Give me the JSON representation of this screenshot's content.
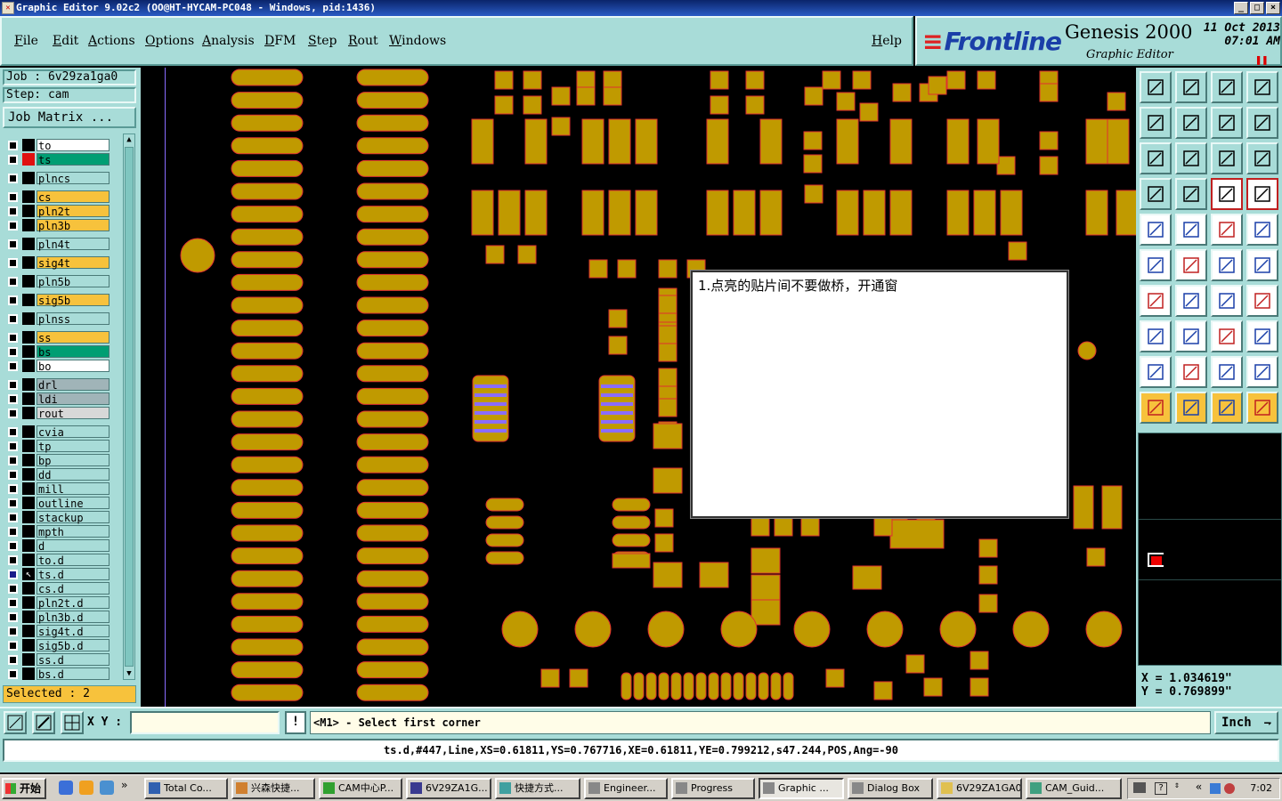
{
  "window": {
    "title": "Graphic Editor 9.02c2 (OO@HT-HYCAM-PC048 - Windows, pid:1436)"
  },
  "menu": {
    "items": [
      "File",
      "Edit",
      "Actions",
      "Options",
      "Analysis",
      "DFM",
      "Step",
      "Rout",
      "Windows"
    ],
    "help": "Help"
  },
  "brand": {
    "logo": "Frontline",
    "product": "Genesis 2000",
    "subtitle": "Graphic Editor",
    "date_line1": "11 Oct 2013",
    "date_line2": "07:01 AM"
  },
  "left_panel": {
    "job": "Job : 6v29za1ga0",
    "step": "Step: cam",
    "job_matrix": "Job Matrix ...",
    "selected": "Selected : 2",
    "layers": [
      {
        "name": "to",
        "color": "#ffffff",
        "swatch": "#000000"
      },
      {
        "name": "ts",
        "color": "#009e73",
        "swatch": "#e01010"
      },
      {
        "name": "plncs",
        "color": "#a8dcd8",
        "swatch": "#000000"
      },
      {
        "name": "cs",
        "color": "#f7c23c",
        "swatch": "#000000"
      },
      {
        "name": "pln2t",
        "color": "#f7c23c",
        "swatch": "#000000"
      },
      {
        "name": "pln3b",
        "color": "#f7c23c",
        "swatch": "#000000"
      },
      {
        "name": "pln4t",
        "color": "#a8dcd8",
        "swatch": "#000000"
      },
      {
        "name": "sig4t",
        "color": "#f7c23c",
        "swatch": "#000000"
      },
      {
        "name": "pln5b",
        "color": "#a8dcd8",
        "swatch": "#000000"
      },
      {
        "name": "sig5b",
        "color": "#f7c23c",
        "swatch": "#000000"
      },
      {
        "name": "plnss",
        "color": "#a8dcd8",
        "swatch": "#000000"
      },
      {
        "name": "ss",
        "color": "#f7c23c",
        "swatch": "#000000"
      },
      {
        "name": "bs",
        "color": "#009e73",
        "swatch": "#000000"
      },
      {
        "name": "bo",
        "color": "#ffffff",
        "swatch": "#000000"
      },
      {
        "name": "drl",
        "color": "#a0b4b8",
        "swatch": "#000000"
      },
      {
        "name": "ldi",
        "color": "#a0b4b8",
        "swatch": "#000000"
      },
      {
        "name": "rout",
        "color": "#d8d8d8",
        "swatch": "#000000"
      },
      {
        "name": "cvia",
        "color": "#a8dcd8",
        "swatch": "#000000"
      },
      {
        "name": "tp",
        "color": "#a8dcd8",
        "swatch": "#000000"
      },
      {
        "name": "bp",
        "color": "#a8dcd8",
        "swatch": "#000000"
      },
      {
        "name": "dd",
        "color": "#a8dcd8",
        "swatch": "#000000"
      },
      {
        "name": "mill",
        "color": "#a8dcd8",
        "swatch": "#000000"
      },
      {
        "name": "outline",
        "color": "#a8dcd8",
        "swatch": "#000000"
      },
      {
        "name": "stackup",
        "color": "#a8dcd8",
        "swatch": "#000000"
      },
      {
        "name": "mpth",
        "color": "#a8dcd8",
        "swatch": "#000000"
      },
      {
        "name": "d",
        "color": "#a8dcd8",
        "swatch": "#000000"
      },
      {
        "name": "to.d",
        "color": "#a8dcd8",
        "swatch": "#000000"
      },
      {
        "name": "ts.d",
        "color": "#a8dcd8",
        "swatch": "#000000"
      },
      {
        "name": "cs.d",
        "color": "#a8dcd8",
        "swatch": "#000000"
      },
      {
        "name": "pln2t.d",
        "color": "#a8dcd8",
        "swatch": "#000000"
      },
      {
        "name": "pln3b.d",
        "color": "#a8dcd8",
        "swatch": "#000000"
      },
      {
        "name": "sig4t.d",
        "color": "#a8dcd8",
        "swatch": "#000000"
      },
      {
        "name": "sig5b.d",
        "color": "#a8dcd8",
        "swatch": "#000000"
      },
      {
        "name": "ss.d",
        "color": "#a8dcd8",
        "swatch": "#000000"
      },
      {
        "name": "bs.d",
        "color": "#a8dcd8",
        "swatch": "#000000"
      }
    ]
  },
  "dialog": {
    "message": "1.点亮的贴片间不要做桥，开通窗"
  },
  "coords": {
    "x": "X = 1.034619\"",
    "y": "Y = 0.769899\""
  },
  "command_bar": {
    "xy_label": "X Y :",
    "xy_value": "",
    "excl": "!",
    "prompt": "<M1> - Select first corner",
    "units": "Inch"
  },
  "status": {
    "line": "ts.d,#447,Line,XS=0.61811,YS=0.767716,XE=0.61811,YE=0.799212,s47.244,POS,Ang=-90"
  },
  "taskbar": {
    "start": "开始",
    "tasks": [
      "Total Co...",
      "兴森快捷...",
      "CAM中心P...",
      "6V29ZA1G...",
      "快捷方式...",
      "Engineer...",
      "Progress",
      "Graphic ...",
      "Dialog Box",
      "6V29ZA1GA0",
      "CAM_Guid..."
    ],
    "clock": "7:02"
  },
  "colors": {
    "panel": "#a8dcd8",
    "pad": "#c09a00",
    "pad_outline": "#e03030",
    "highlight": "#8a6cff"
  },
  "icons": {
    "toolbar": [
      "fill-icon",
      "move-icon",
      "home-icon",
      "window-icon",
      "prev-icon",
      "next-icon",
      "rotate-icon",
      "redraw-icon",
      "zoom-fit-icon",
      "pan-icon",
      "scale-1-2-icon",
      "help-icon",
      "measure-icon",
      "grid-icon",
      "snap-icon",
      "snap-red-icon",
      "circle-icon",
      "polygon-icon",
      "ruler-icon",
      "dot-icon",
      "node-icon",
      "cross-icon",
      "arc-icon",
      "arrow-icon",
      "angle-icon",
      "line-icon",
      "curve-icon",
      "flip-icon",
      "add-icon",
      "minus-icon",
      "fit-icon",
      "shapes-icon",
      "tri-a-icon",
      "tri-b-icon",
      "tri-c-icon",
      "tri-d-icon",
      "pointer-icon",
      "pointer-box-icon",
      "pointer-orange-icon",
      "net-icon"
    ]
  }
}
